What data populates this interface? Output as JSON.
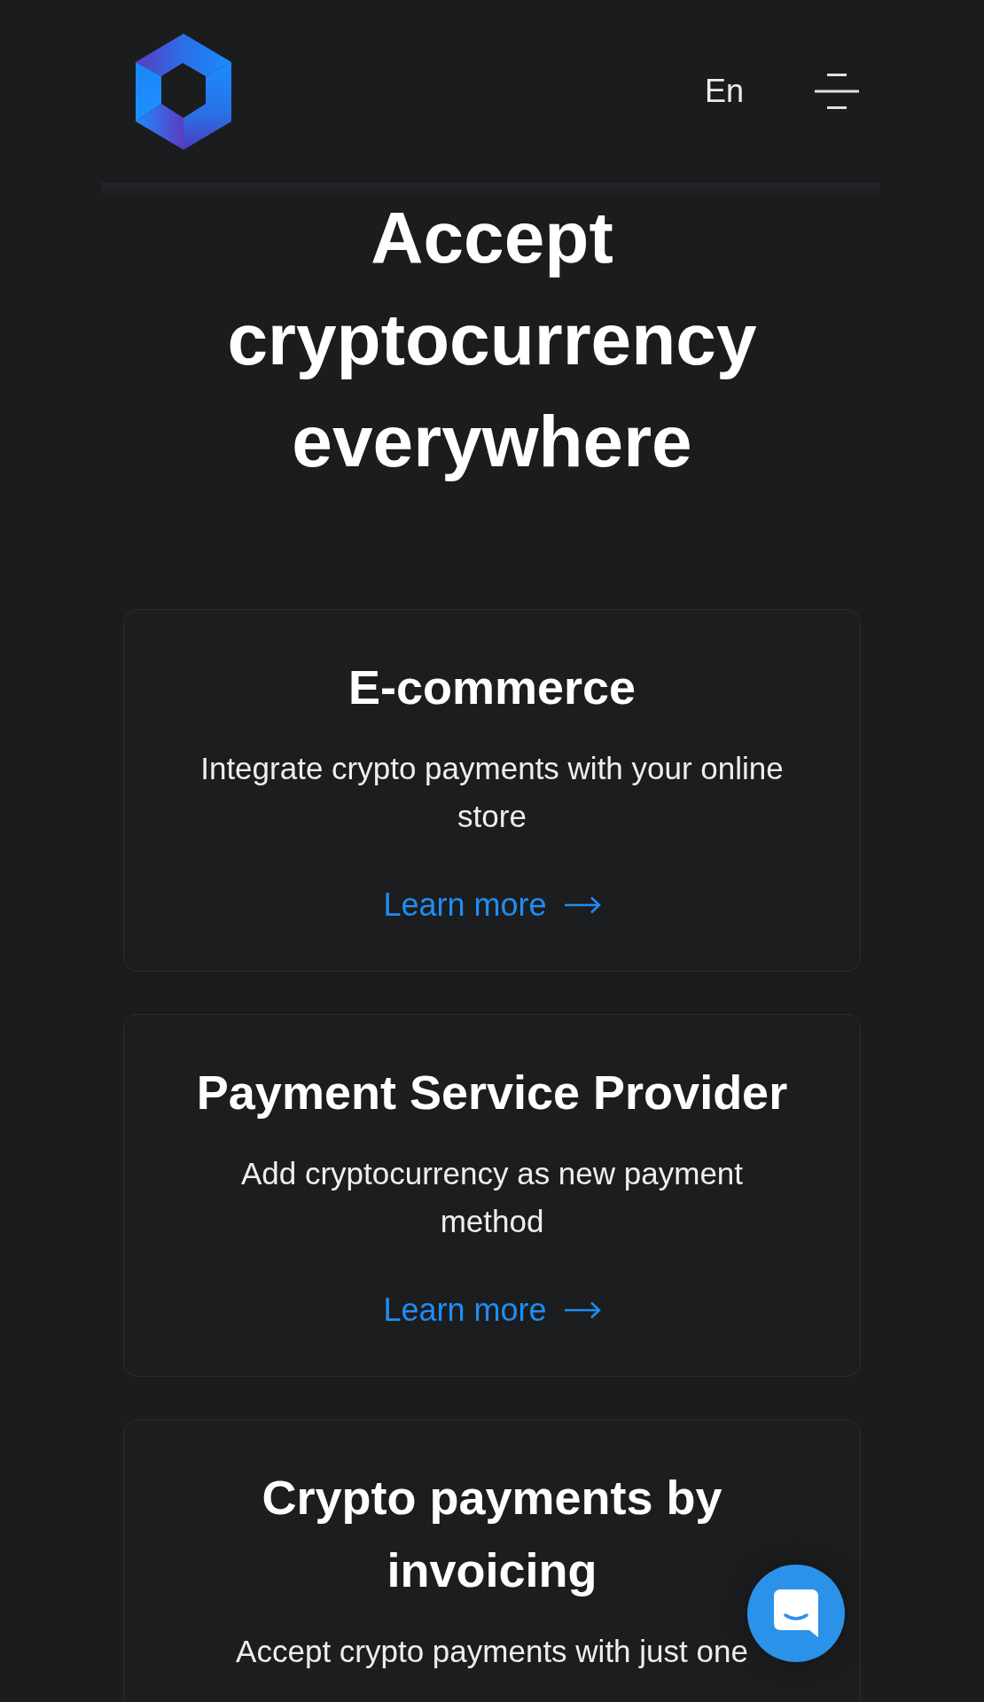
{
  "header": {
    "language": "En"
  },
  "hero": {
    "title": "Accept cryptocurrency everywhere"
  },
  "cards": [
    {
      "title": "E-commerce",
      "description": "Integrate crypto payments with your online store",
      "link": "Learn more"
    },
    {
      "title": "Payment Service Provider",
      "description": "Add cryptocurrency as new payment method",
      "link": "Learn more"
    },
    {
      "title": "Crypto payments by invoicing",
      "description": "Accept crypto payments with just one"
    }
  ]
}
